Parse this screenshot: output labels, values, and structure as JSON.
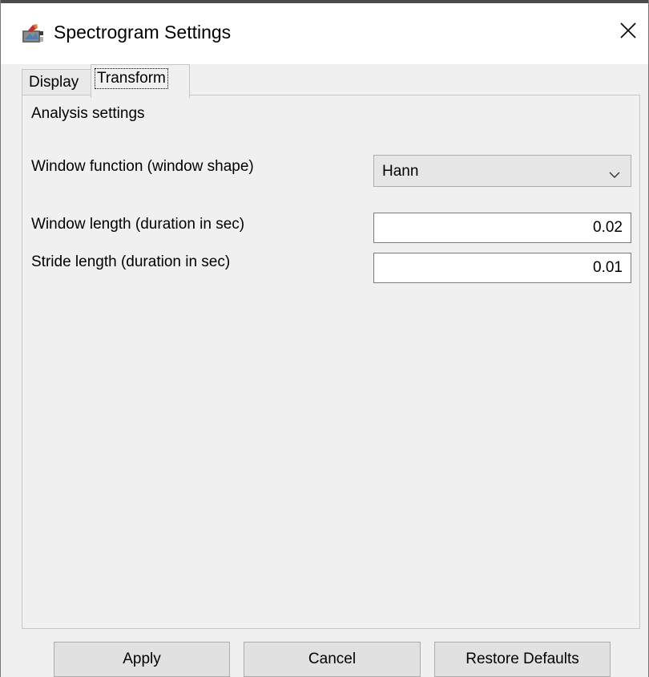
{
  "window": {
    "title": "Spectrogram Settings",
    "icon": "spectrogram-app-icon",
    "close_icon": "close-icon"
  },
  "tabs": [
    {
      "label": "Display",
      "active": false
    },
    {
      "label": "Transform",
      "active": true
    }
  ],
  "panel": {
    "section_title": "Analysis settings",
    "window_function": {
      "label": "Window function (window shape)",
      "selected": "Hann"
    },
    "window_length": {
      "label": "Window length (duration in sec)",
      "value": "0.02"
    },
    "stride_length": {
      "label": "Stride length (duration in sec)",
      "value": "0.01"
    }
  },
  "buttons": {
    "apply": "Apply",
    "cancel": "Cancel",
    "restore": "Restore Defaults"
  }
}
